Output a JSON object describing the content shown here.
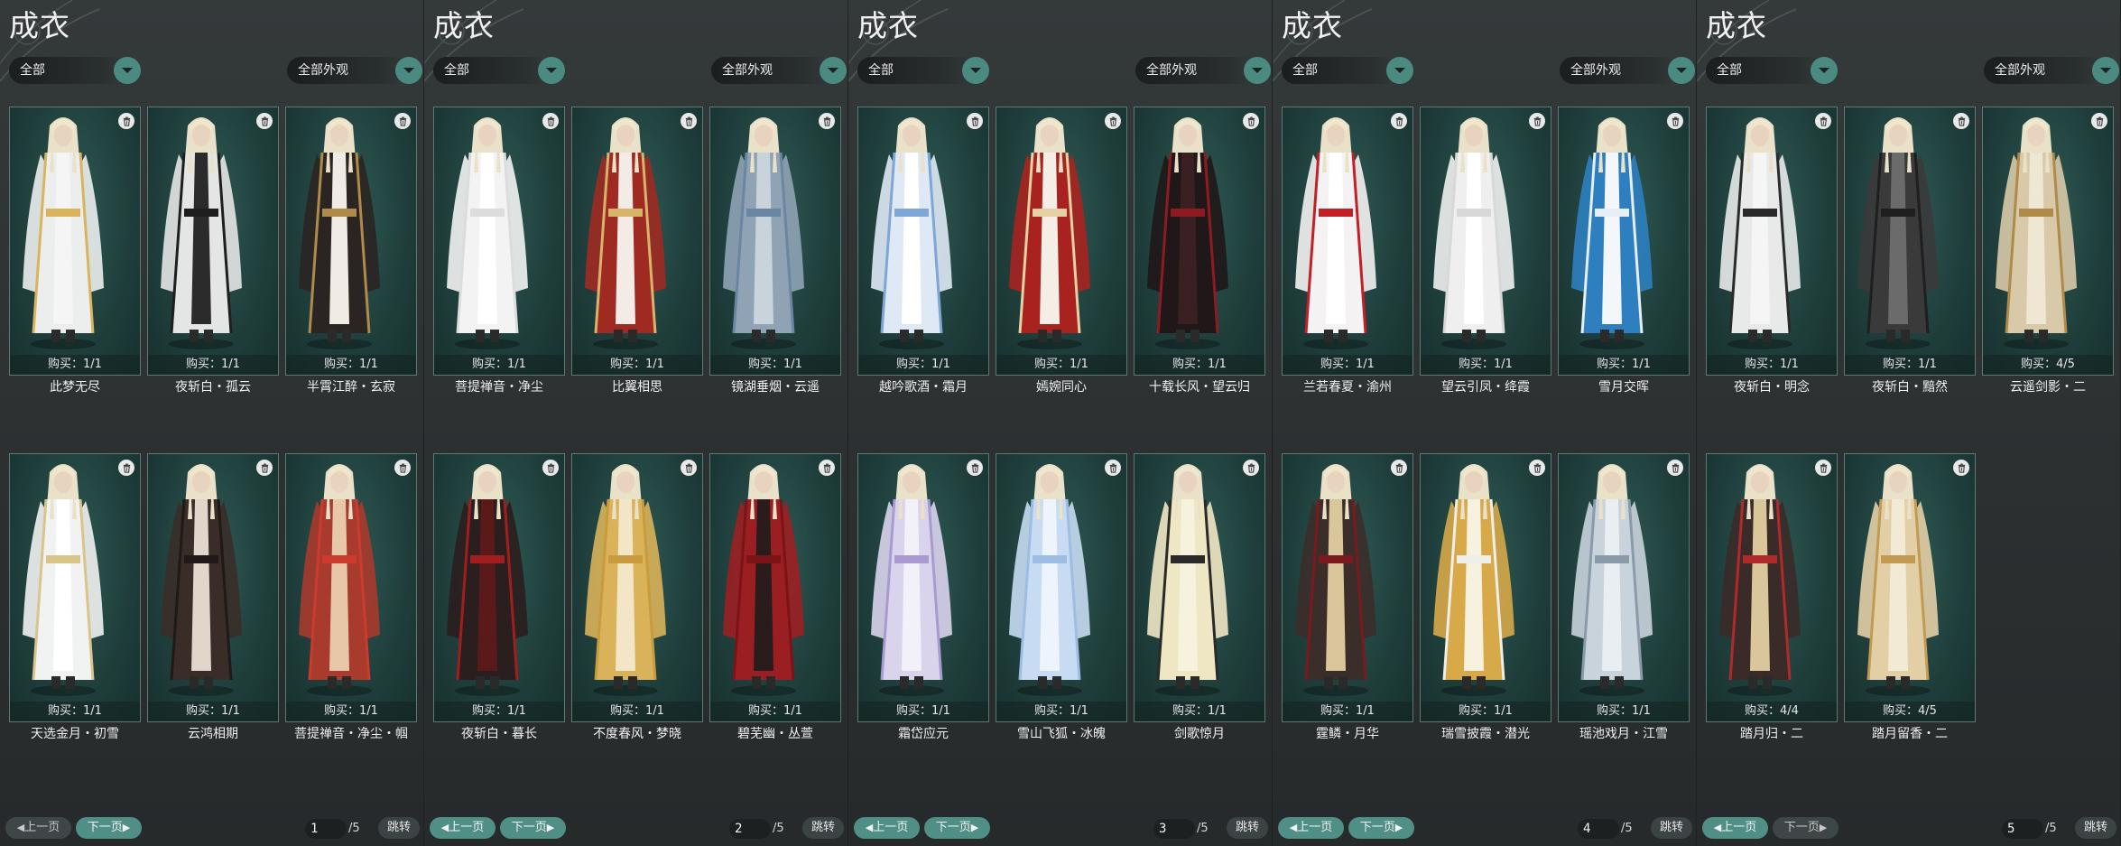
{
  "labels": {
    "title": "成衣",
    "filter_all": "全部",
    "filter_appearance": "全部外观",
    "prev_page": "上一页",
    "next_page": "下一页",
    "jump": "跳转"
  },
  "panels": [
    {
      "page": "1",
      "total": "/5",
      "prev_enabled": false,
      "next_enabled": true,
      "items": [
        {
          "name": "此梦无尽",
          "buy": "购买：1/1",
          "robe": "#eceeee",
          "accent": "#d9b45c",
          "inner": "#f5f5f5"
        },
        {
          "name": "夜斩白・孤云",
          "buy": "购买：1/1",
          "robe": "#e4e6e6",
          "accent": "#1e1e1e",
          "inner": "#2b2b2b"
        },
        {
          "name": "半霄江醉・玄寂",
          "buy": "购买：1/1",
          "robe": "#2a2522",
          "accent": "#b08a4a",
          "inner": "#f0ece4"
        },
        {
          "name": "天选金月・初雪",
          "buy": "购买：1/1",
          "robe": "#f1f2f2",
          "accent": "#d9c48a",
          "inner": "#ffffff"
        },
        {
          "name": "云鸿相期",
          "buy": "购买：1/1",
          "robe": "#3a2d28",
          "accent": "#1f1a17",
          "inner": "#e0d6cc"
        },
        {
          "name": "菩提禅音・净尘・帼",
          "buy": "购买：1/1",
          "robe": "#a83a2e",
          "accent": "#cc3b2c",
          "inner": "#e8c7a8"
        }
      ]
    },
    {
      "page": "2",
      "total": "/5",
      "prev_enabled": true,
      "next_enabled": true,
      "items": [
        {
          "name": "菩提禅音・净尘",
          "buy": "购买：1/1",
          "robe": "#f3f3f3",
          "accent": "#dcdcdc",
          "inner": "#ffffff"
        },
        {
          "name": "比翼相思",
          "buy": "购买：1/1",
          "robe": "#9e2a22",
          "accent": "#d7b46a",
          "inner": "#f3ece6"
        },
        {
          "name": "镜湖垂烟・云遥",
          "buy": "购买：1/1",
          "robe": "#8fa3b5",
          "accent": "#6b86a3",
          "inner": "#c9d3dc"
        },
        {
          "name": "夜斩白・暮长",
          "buy": "购买：1/1",
          "robe": "#2a1e1e",
          "accent": "#a01e1e",
          "inner": "#5a1a1a"
        },
        {
          "name": "不度春风・梦晓",
          "buy": "购买：1/1",
          "robe": "#d9b25a",
          "accent": "#c79b3e",
          "inner": "#f2e6c6"
        },
        {
          "name": "碧芜幽・丛萱",
          "buy": "购买：1/1",
          "robe": "#9b1f22",
          "accent": "#7a1417",
          "inner": "#2a1c1c"
        }
      ]
    },
    {
      "page": "3",
      "total": "/5",
      "prev_enabled": true,
      "next_enabled": true,
      "items": [
        {
          "name": "越吟歌酒・霜月",
          "buy": "购买：1/1",
          "robe": "#dfe9f5",
          "accent": "#7ea6d6",
          "inner": "#ffffff"
        },
        {
          "name": "嫣婉同心",
          "buy": "购买：1/1",
          "robe": "#a8221f",
          "accent": "#e7d0a3",
          "inner": "#f4eee6"
        },
        {
          "name": "十载长风・望云归",
          "buy": "购买：1/1",
          "robe": "#1f1718",
          "accent": "#8e1b22",
          "inner": "#3a2022"
        },
        {
          "name": "霜岱应元",
          "buy": "购买：1/1",
          "robe": "#d9d4ec",
          "accent": "#a99ad2",
          "inner": "#f2f0f8"
        },
        {
          "name": "雪山飞狐・冰魄",
          "buy": "购买：1/1",
          "robe": "#c7dcf2",
          "accent": "#9dbde3",
          "inner": "#eef4fb"
        },
        {
          "name": "剑歌惊月",
          "buy": "购买：1/1",
          "robe": "#efe7c4",
          "accent": "#2a2a2a",
          "inner": "#f7f2de"
        }
      ]
    },
    {
      "page": "4",
      "total": "/5",
      "prev_enabled": true,
      "next_enabled": true,
      "items": [
        {
          "name": "兰若春夏・渝州",
          "buy": "购买：1/1",
          "robe": "#f4f2f2",
          "accent": "#c41f26",
          "inner": "#ffffff"
        },
        {
          "name": "望云引凤・绛霞",
          "buy": "购买：1/1",
          "robe": "#efefef",
          "accent": "#d8d8d8",
          "inner": "#ffffff"
        },
        {
          "name": "雪月交晖",
          "buy": "购买：1/1",
          "robe": "#2e7fc0",
          "accent": "#e6eef6",
          "inner": "#f3f7fb"
        },
        {
          "name": "霆鳞・月华",
          "buy": "购买：1/1",
          "robe": "#3b2d2a",
          "accent": "#7a1a1f",
          "inner": "#d9c69a"
        },
        {
          "name": "瑞雪披霞・潜光",
          "buy": "购买：1/1",
          "robe": "#d7a948",
          "accent": "#f0eee8",
          "inner": "#f7f1df"
        },
        {
          "name": "瑶池戏月・江雪",
          "buy": "购买：1/1",
          "robe": "#c9d3dc",
          "accent": "#8a9aa8",
          "inner": "#e9eef2"
        }
      ]
    },
    {
      "page": "5",
      "total": "/5",
      "prev_enabled": true,
      "next_enabled": false,
      "items": [
        {
          "name": "夜斩白・明念",
          "buy": "购买：1/1",
          "robe": "#e8eaea",
          "accent": "#2a2a2a",
          "inner": "#f5f5f5"
        },
        {
          "name": "夜斩白・黯然",
          "buy": "购买：1/1",
          "robe": "#3a3a3b",
          "accent": "#1f1f1f",
          "inner": "#6b6b6b"
        },
        {
          "name": "云遥剑影・二",
          "buy": "购买：4/5",
          "robe": "#d8c9a8",
          "accent": "#b08a4a",
          "inner": "#efe6d3"
        },
        {
          "name": "踏月归・二",
          "buy": "购买：4/4",
          "robe": "#3a2a28",
          "accent": "#b02a2a",
          "inner": "#d9c69a"
        },
        {
          "name": "踏月留香・二",
          "buy": "购买：4/5",
          "robe": "#e2cfa6",
          "accent": "#c29a52",
          "inner": "#f3ead6"
        }
      ]
    }
  ]
}
